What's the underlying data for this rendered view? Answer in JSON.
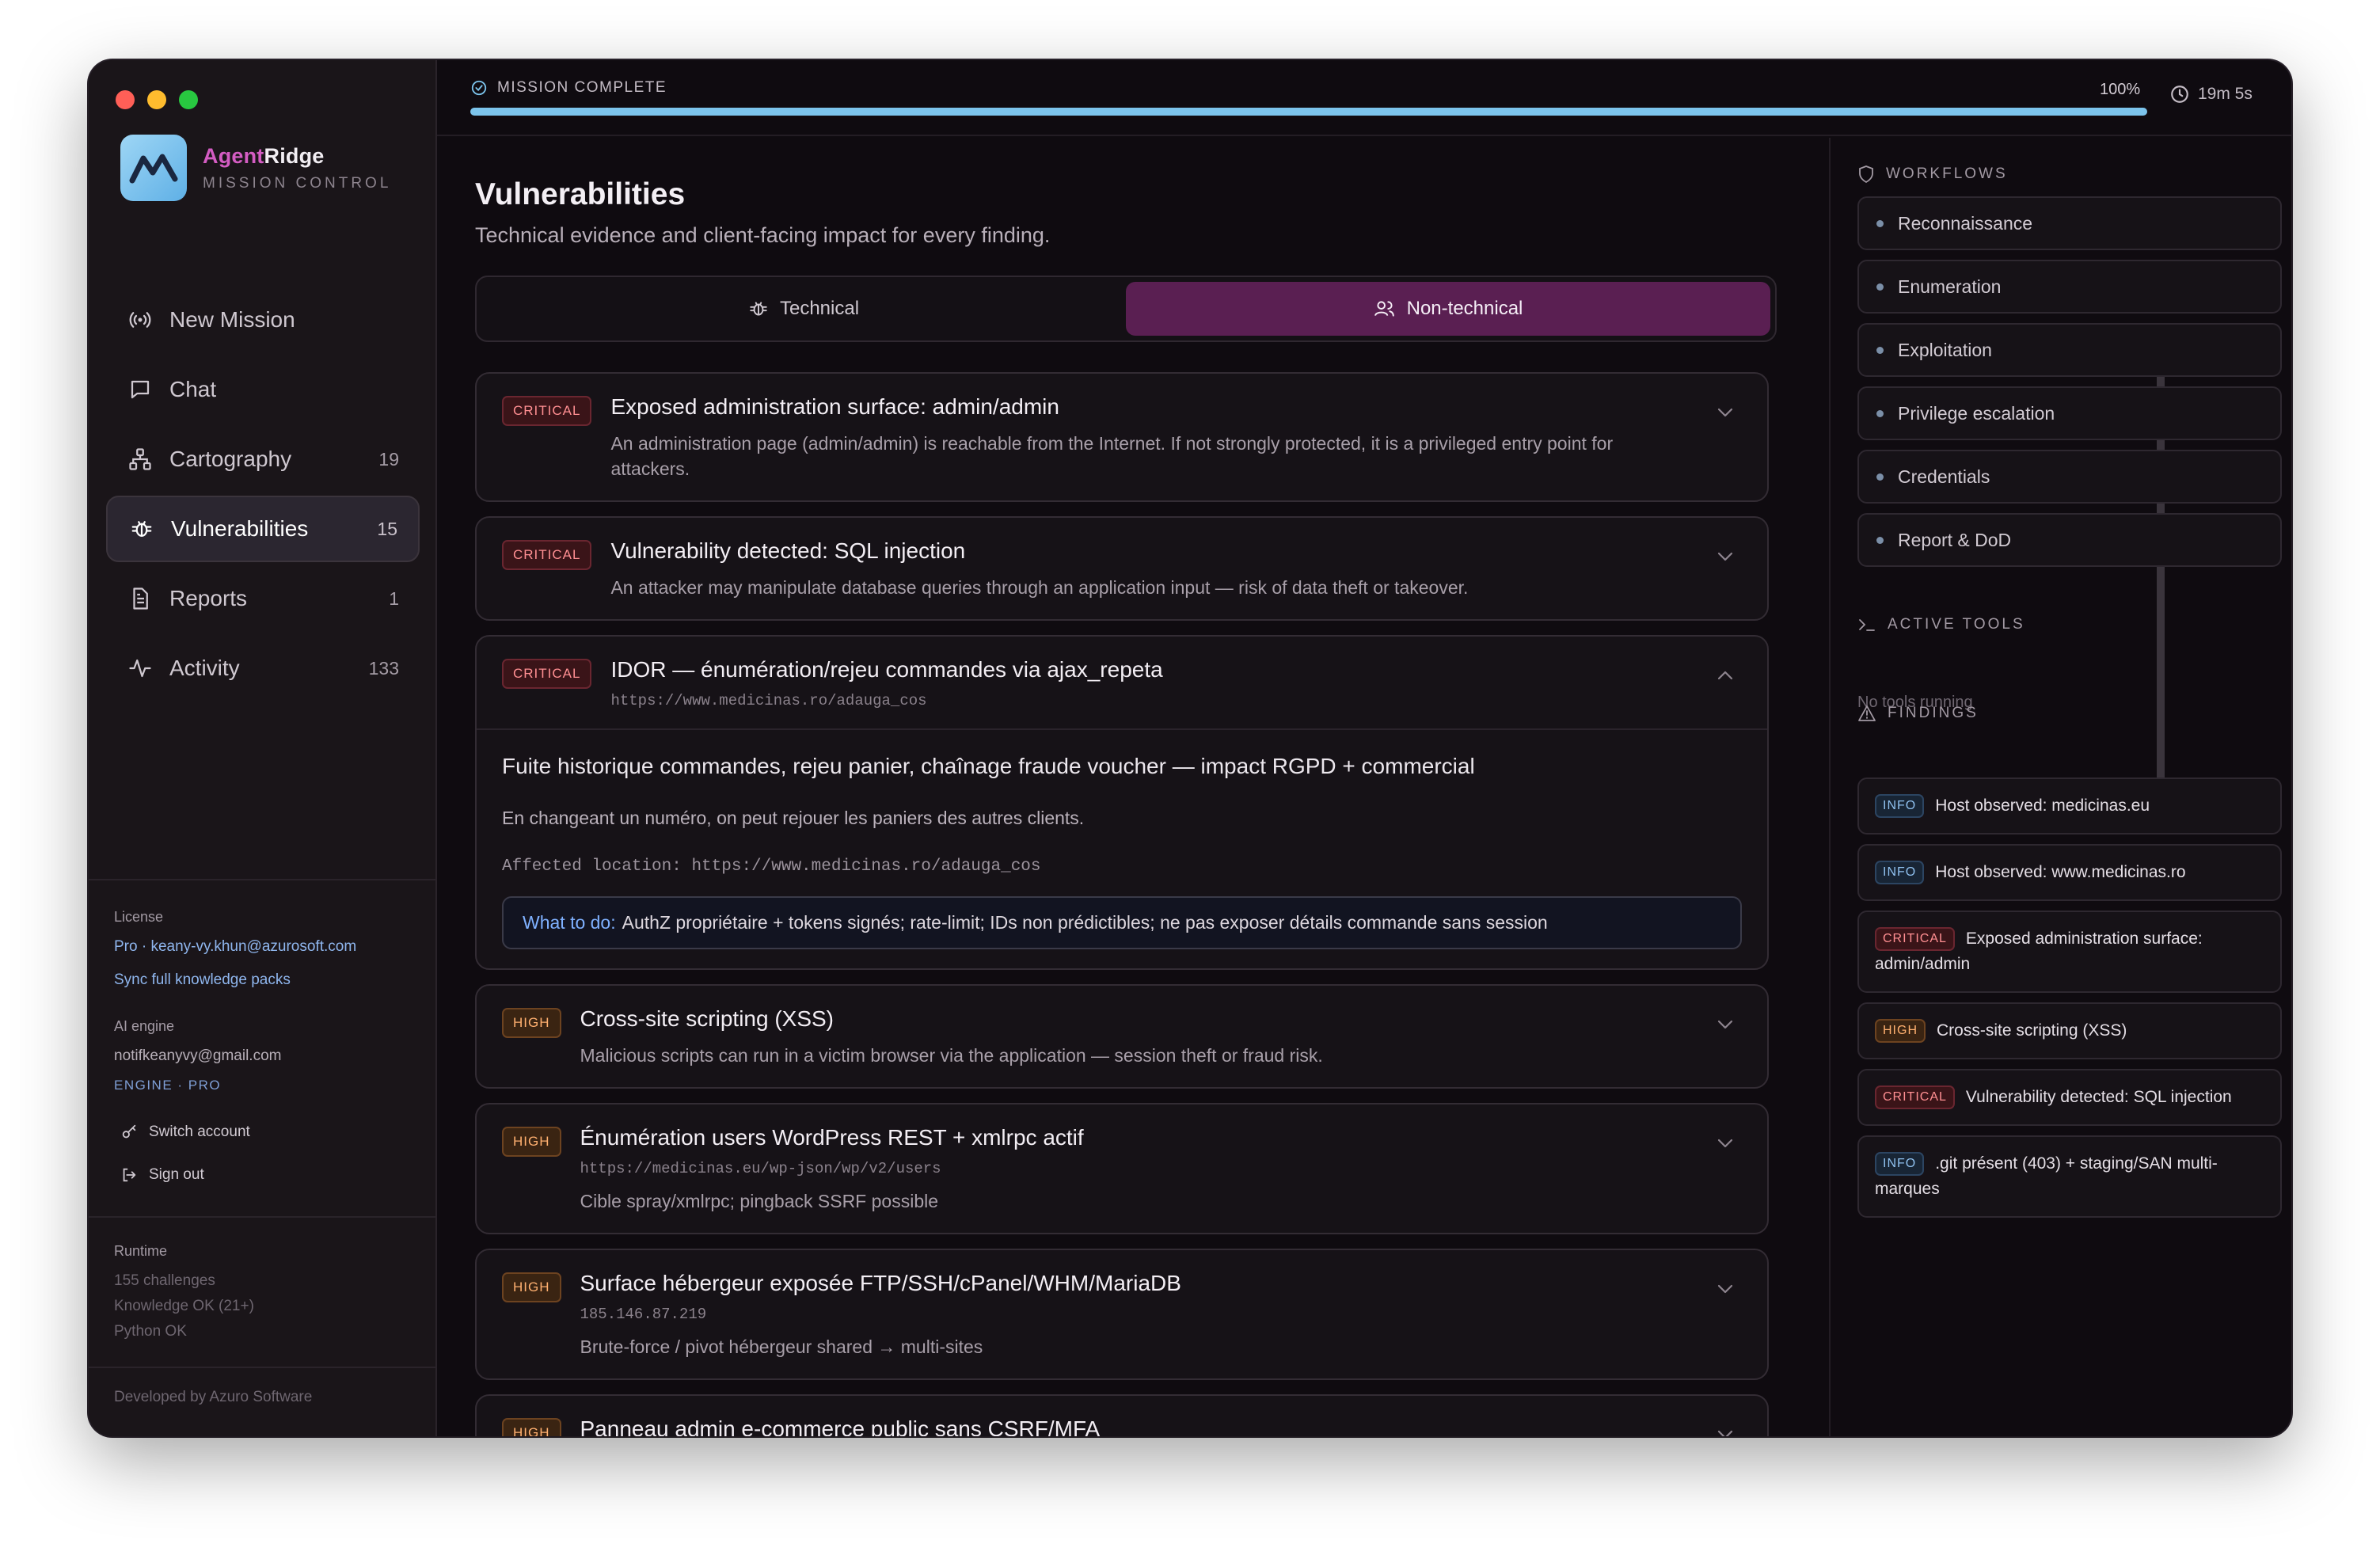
{
  "brand": {
    "name_accent": "Agent",
    "name_rest": "Ridge",
    "subtitle": "MISSION CONTROL"
  },
  "nav": [
    {
      "label": "New Mission",
      "count": "",
      "icon": "broadcast-icon"
    },
    {
      "label": "Chat",
      "count": "",
      "icon": "chat-icon"
    },
    {
      "label": "Cartography",
      "count": "19",
      "icon": "sitemap-icon"
    },
    {
      "label": "Vulnerabilities",
      "count": "15",
      "icon": "bug-icon",
      "active": true
    },
    {
      "label": "Reports",
      "count": "1",
      "icon": "document-icon"
    },
    {
      "label": "Activity",
      "count": "133",
      "icon": "activity-icon"
    }
  ],
  "license": {
    "heading": "License",
    "plan": "Pro · keany-vy.khun@azurosoft.com",
    "sync": "Sync full knowledge packs"
  },
  "ai_engine": {
    "heading": "AI engine",
    "email": "notifkeanyvy@gmail.com",
    "tag": "ENGINE · PRO",
    "switch": "Switch account",
    "signout": "Sign out"
  },
  "runtime": {
    "heading": "Runtime",
    "challenges": "155 challenges",
    "knowledge": "Knowledge OK (21+)",
    "python": "Python OK"
  },
  "footer": "Developed by Azuro Software",
  "topbar": {
    "status": "MISSION COMPLETE",
    "progress": 1.0,
    "percent": "100%",
    "timer": "19m 5s"
  },
  "page": {
    "title": "Vulnerabilities",
    "subtitle": "Technical evidence and client-facing impact for every finding."
  },
  "tabs": [
    {
      "label": "Technical",
      "active": false
    },
    {
      "label": "Non-technical",
      "active": true
    }
  ],
  "findings": [
    {
      "severity": "CRITICAL",
      "title": "Exposed administration surface: admin/admin",
      "description": "An administration page (admin/admin) is reachable from the Internet. If not strongly protected, it is a privileged entry point for attackers.",
      "url": "",
      "expanded": false
    },
    {
      "severity": "CRITICAL",
      "title": "Vulnerability detected: SQL injection",
      "description": "An attacker may manipulate database queries through an application input — risk of data theft or takeover.",
      "url": "",
      "expanded": false
    },
    {
      "severity": "CRITICAL",
      "title": "IDOR — énumération/rejeu commandes via ajax_repeta",
      "description": "",
      "url": "https://www.medicinas.ro/adauga_cos",
      "expanded": true,
      "detail": {
        "headline": "Fuite historique commandes, rejeu panier, chaînage fraude voucher — impact RGPD + commercial",
        "text": "En changeant un numéro, on peut rejouer les paniers des autres clients.",
        "location": "Affected location: https://www.medicinas.ro/adauga_cos",
        "todo_label": "What to do:",
        "todo_text": "AuthZ propriétaire + tokens signés; rate-limit; IDs non prédictibles; ne pas exposer détails commande sans session"
      }
    },
    {
      "severity": "HIGH",
      "title": "Cross-site scripting (XSS)",
      "description": "Malicious scripts can run in a victim browser via the application — session theft or fraud risk.",
      "url": "",
      "expanded": false
    },
    {
      "severity": "HIGH",
      "title": "Énumération users WordPress REST + xmlrpc actif",
      "description": "Cible spray/xmlrpc; pingback SSRF possible",
      "url": "https://medicinas.eu/wp-json/wp/v2/users",
      "expanded": false
    },
    {
      "severity": "HIGH",
      "title": "Surface hébergeur exposée FTP/SSH/cPanel/WHM/MariaDB",
      "description": "Brute-force / pivot hébergeur shared → multi-sites",
      "url": "185.146.87.219",
      "expanded": false
    },
    {
      "severity": "HIGH",
      "title": "Panneau admin e-commerce public sans CSRF/MFA",
      "description": "",
      "url": "",
      "expanded": false
    }
  ],
  "right": {
    "workflows_heading": "WORKFLOWS",
    "workflows": [
      "Reconnaissance",
      "Enumeration",
      "Exploitation",
      "Privilege escalation",
      "Credentials",
      "Report & DoD"
    ],
    "tools_heading": "ACTIVE TOOLS",
    "tools_empty": "No tools running",
    "findings_heading": "FINDINGS",
    "findings": [
      {
        "severity": "INFO",
        "text": "Host observed: medicinas.eu"
      },
      {
        "severity": "INFO",
        "text": "Host observed: www.medicinas.ro"
      },
      {
        "severity": "CRITICAL",
        "text": "Exposed administration surface: admin/admin"
      },
      {
        "severity": "HIGH",
        "text": "Cross-site scripting (XSS)"
      },
      {
        "severity": "CRITICAL",
        "text": "Vulnerability detected: SQL injection"
      },
      {
        "severity": "INFO",
        "text": ".git présent (403) + staging/SAN multi-marques"
      }
    ]
  },
  "colors": {
    "accent": "#5a1f52",
    "progress": "#7cc4ec",
    "critical": "#ff8f92",
    "high": "#ffb070",
    "info": "#8fc0ee",
    "brand_accent": "#d45cc3"
  }
}
